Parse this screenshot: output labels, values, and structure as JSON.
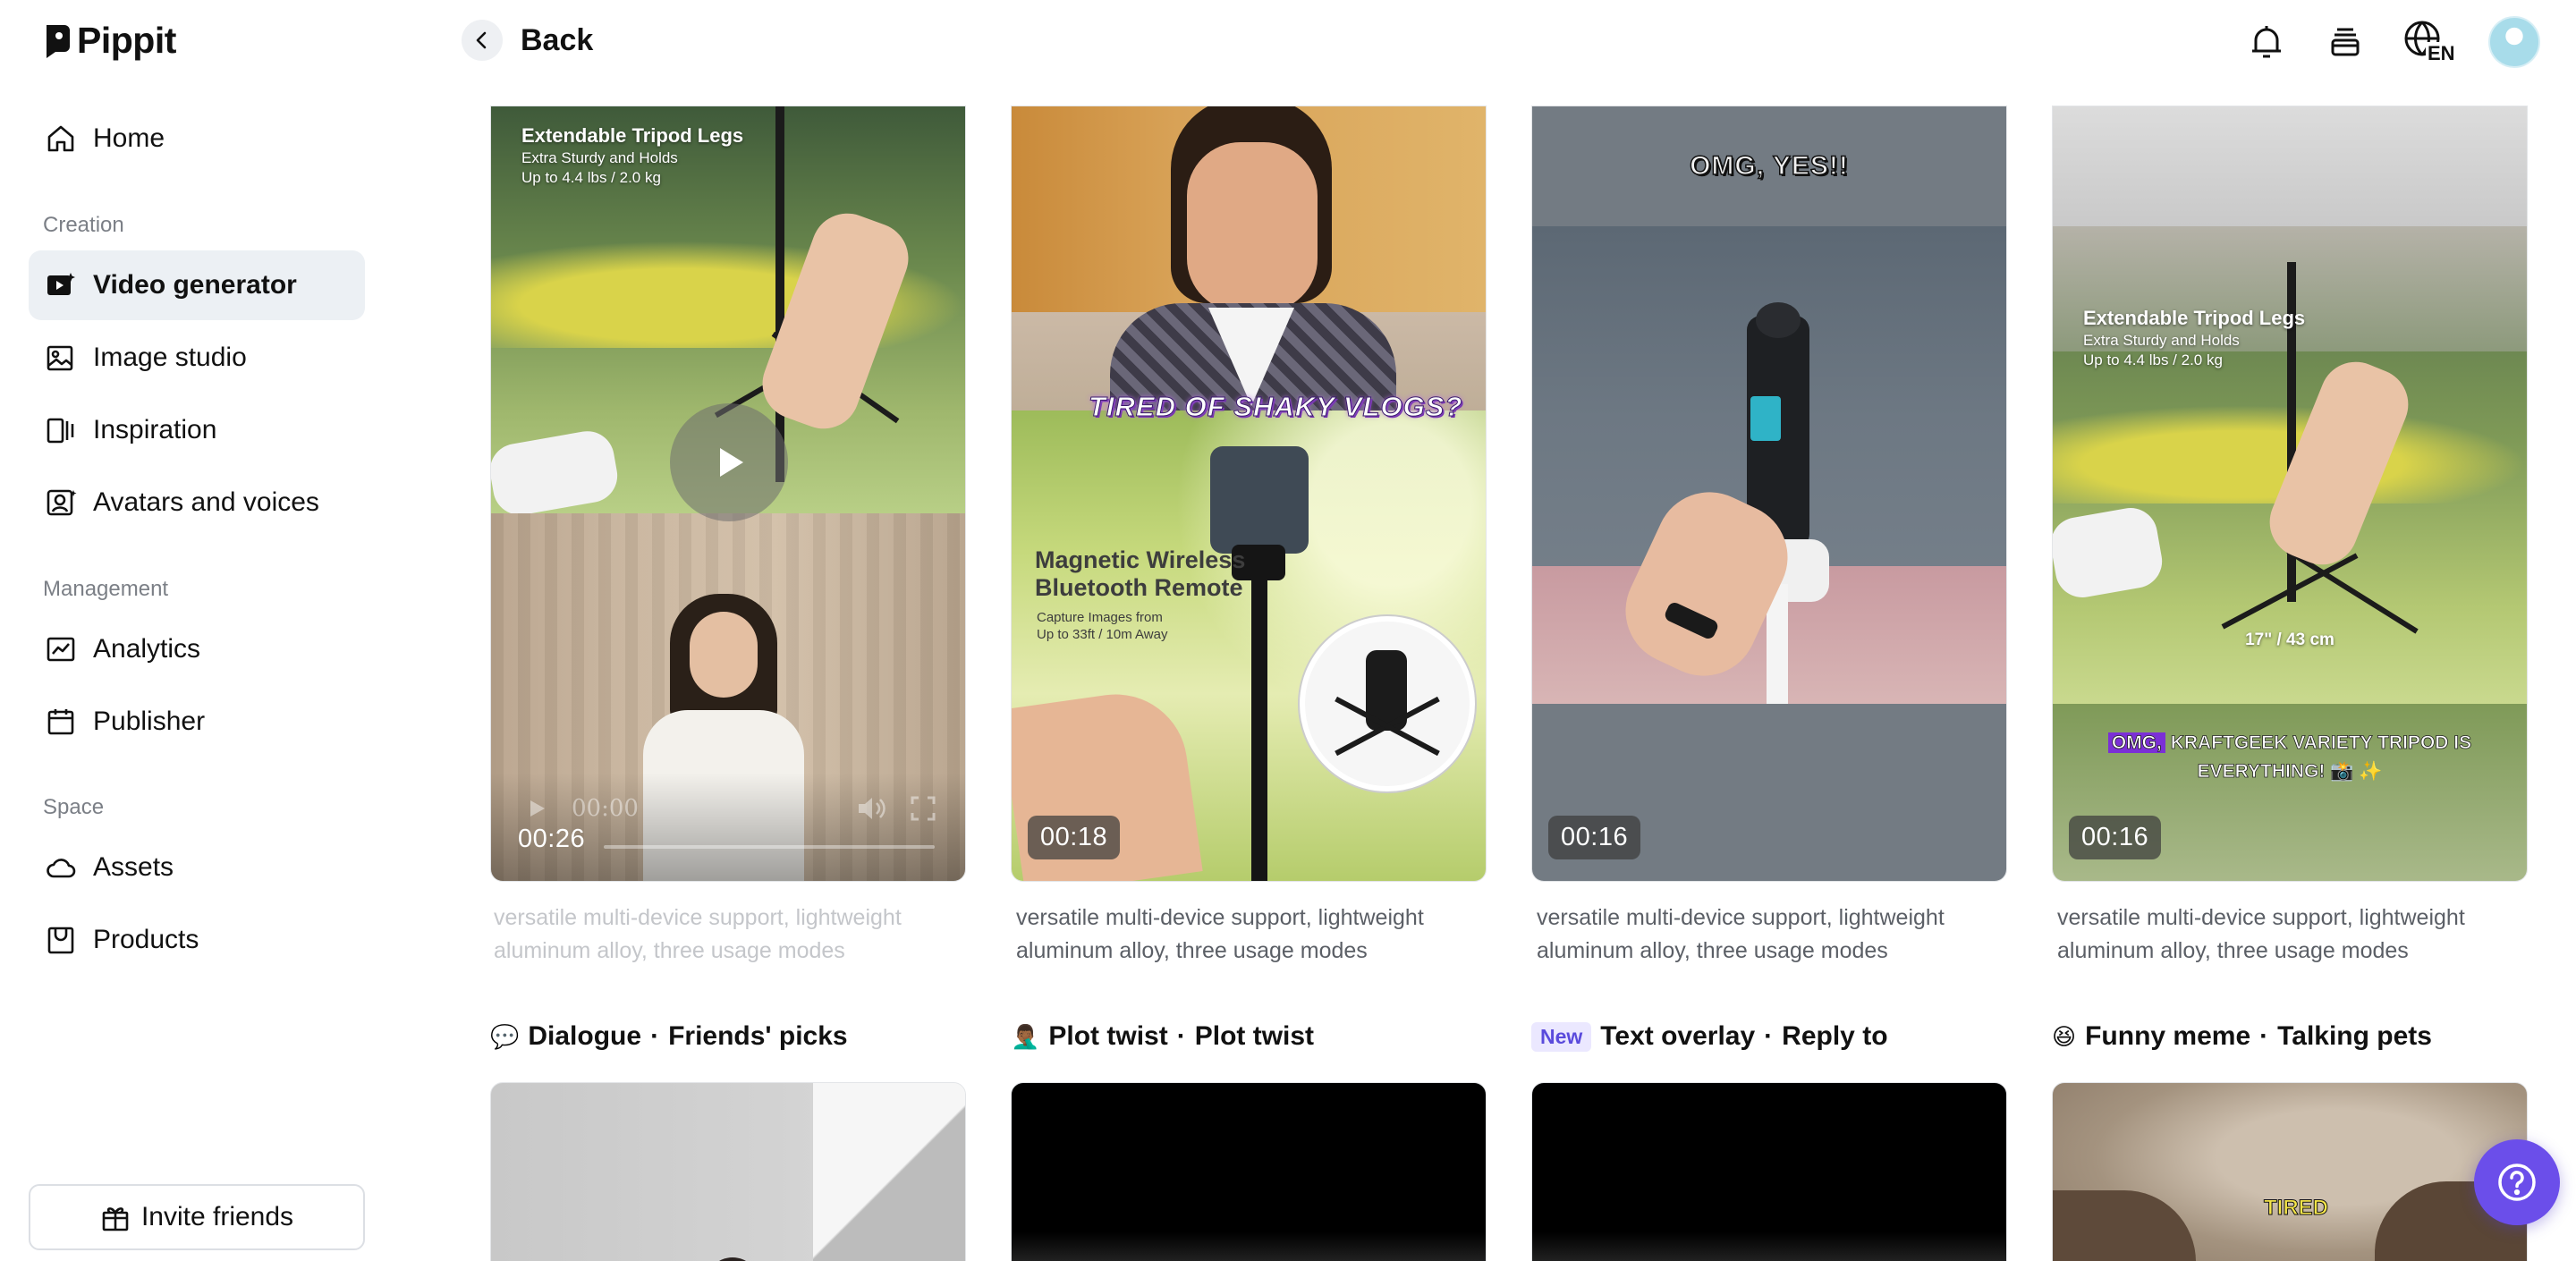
{
  "app": {
    "name": "Pippit"
  },
  "topbar": {
    "back_label": "Back",
    "language_code": "EN"
  },
  "sidebar": {
    "home": "Home",
    "section_creation": "Creation",
    "video_generator": "Video generator",
    "image_studio": "Image studio",
    "inspiration": "Inspiration",
    "avatars_voices": "Avatars and voices",
    "section_management": "Management",
    "analytics": "Analytics",
    "publisher": "Publisher",
    "section_space": "Space",
    "assets": "Assets",
    "products": "Products",
    "invite_friends": "Invite friends"
  },
  "row1": {
    "cards": [
      {
        "duration": "00:26",
        "player_time": "00:00",
        "overlay_title": "Extendable Tripod Legs",
        "overlay_sub1": "Extra Sturdy and Holds",
        "overlay_sub2": "Up to 4.4 lbs / 2.0 kg",
        "desc_line1": "versatile multi-device support, lightweight",
        "desc_line2": "aluminum alloy, three usage modes"
      },
      {
        "duration": "00:18",
        "caption": "TIRED OF SHAKY VLOGS?",
        "overlay_title1": "Magnetic Wireless",
        "overlay_title2": "Bluetooth Remote",
        "overlay_sub1": "Capture Images from",
        "overlay_sub2": "Up to 33ft / 10m Away",
        "desc_line1": "versatile multi-device support, lightweight",
        "desc_line2": "aluminum alloy, three usage modes"
      },
      {
        "duration": "00:16",
        "caption": "OMG, YES!!",
        "desc_line1": "versatile multi-device support, lightweight",
        "desc_line2": "aluminum alloy, three usage modes"
      },
      {
        "duration": "00:16",
        "overlay_title": "Extendable Tripod Legs",
        "overlay_sub1": "Extra Sturdy and Holds",
        "overlay_sub2": "Up to 4.4 lbs / 2.0 kg",
        "measure": "17\" / 43 cm",
        "caption_hl": "OMG,",
        "caption_rest": " KRAFTGEEK VARIETY TRIPOD IS",
        "caption_line2": "EVERYTHING! 📸 ✨",
        "desc_line1": "versatile multi-device support, lightweight",
        "desc_line2": "aluminum alloy, three usage modes"
      }
    ]
  },
  "row2": {
    "cards": [
      {
        "emoji": "💬",
        "category": "Dialogue",
        "sep": "·",
        "tag": "Friends' picks"
      },
      {
        "emoji": "🤦🏾‍♂️",
        "category": "Plot twist",
        "sep": "·",
        "tag": "Plot twist"
      },
      {
        "badge": "New",
        "category": "Text overlay",
        "sep": "·",
        "tag": "Reply to"
      },
      {
        "emoji": "😆",
        "category": "Funny meme",
        "sep": "·",
        "tag": "Talking pets",
        "caption": "TIRED"
      }
    ]
  },
  "colors": {
    "accent": "#6b4eea",
    "active_nav_bg": "#ecf0f4"
  }
}
